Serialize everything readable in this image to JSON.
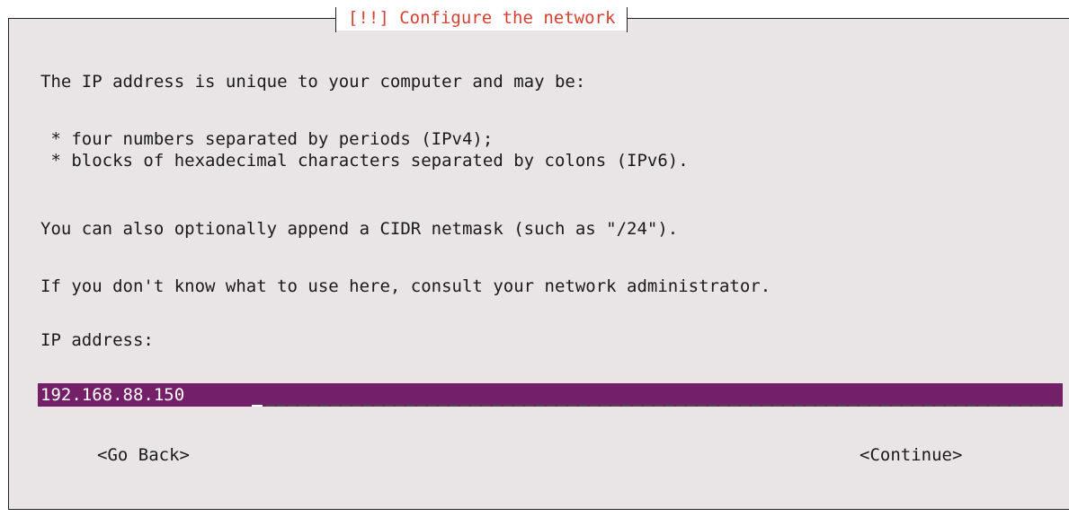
{
  "dialog": {
    "title": "[!!] Configure the network"
  },
  "body": {
    "intro": "The IP address is unique to your computer and may be:",
    "bullets": [
      " * four numbers separated by periods (IPv4);",
      " * blocks of hexadecimal characters separated by colons (IPv6)."
    ],
    "cidr_note": "You can also optionally append a CIDR netmask (such as \"/24\").",
    "admin_note": "If you don't know what to use here, consult your network administrator.",
    "field_label": "IP address:"
  },
  "ip_input": {
    "value": "192.168.88.150"
  },
  "buttons": {
    "back": "<Go Back>",
    "continue": "<Continue>"
  },
  "colors": {
    "dialog_bg": "#e9e4e6",
    "title_text": "#d9402f",
    "input_bg": "#742068"
  }
}
